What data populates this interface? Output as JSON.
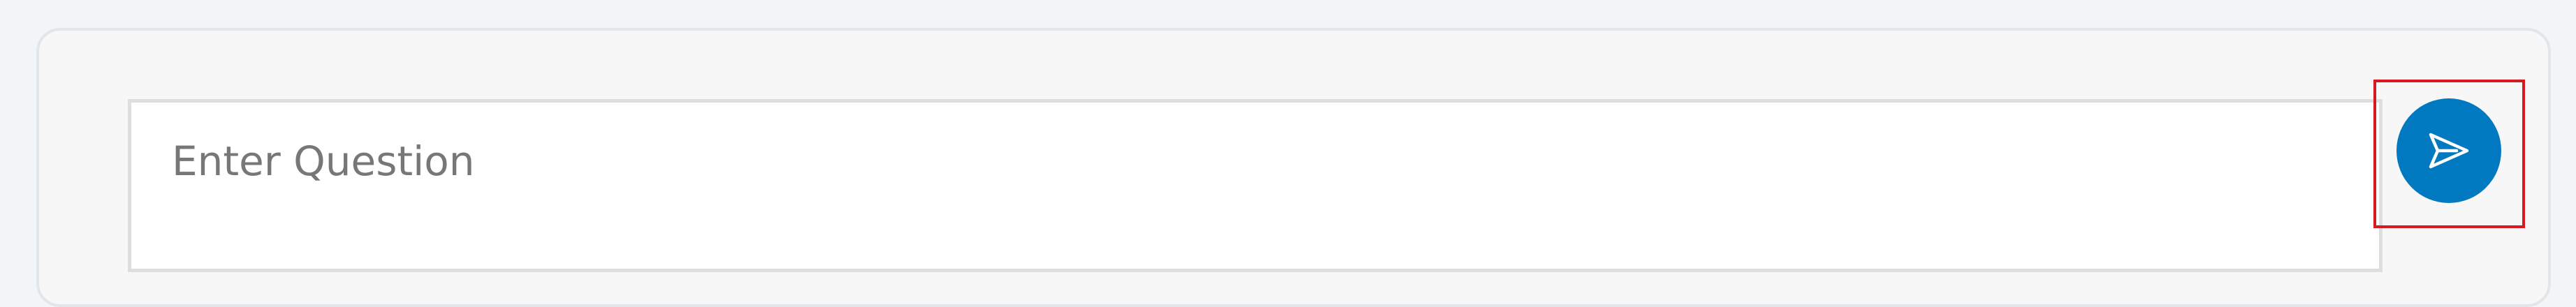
{
  "composer": {
    "placeholder": "Enter Question",
    "send_icon": "send-icon",
    "accent_color": "#0079c1",
    "highlight_color": "#d71920"
  }
}
